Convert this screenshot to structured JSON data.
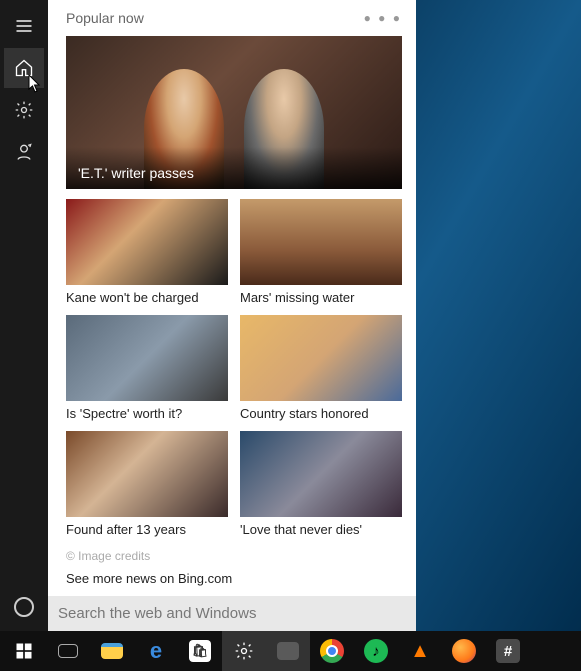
{
  "panel": {
    "header_title": "Popular now",
    "hero": {
      "caption": "'E.T.' writer passes"
    },
    "tiles": [
      {
        "label": "Kane won't be charged"
      },
      {
        "label": "Mars' missing water"
      },
      {
        "label": "Is 'Spectre' worth it?"
      },
      {
        "label": "Country stars honored"
      },
      {
        "label": "Found after 13 years"
      },
      {
        "label": "'Love that never dies'"
      }
    ],
    "image_credits": "© Image credits",
    "see_more": "See more news on Bing.com",
    "search_placeholder": "Search the web and Windows"
  },
  "rail": {
    "items": [
      "menu",
      "home",
      "settings",
      "feedback",
      "cortana"
    ]
  },
  "taskbar": {
    "items": [
      "start",
      "taskview",
      "file-explorer",
      "edge",
      "store",
      "settings",
      "task-manager",
      "chrome",
      "spotify",
      "vlc",
      "firefox",
      "slack"
    ]
  }
}
